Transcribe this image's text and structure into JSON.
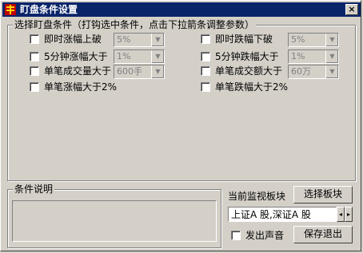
{
  "window": {
    "title": "盯盘条件设置",
    "close_label": "×"
  },
  "conditions_group": {
    "legend": "选择盯盘条件（打钩选中条件，点击下拉箭条调整参数）"
  },
  "left_conditions": [
    {
      "label": "即时涨幅上破",
      "value": "5%",
      "checked": false
    },
    {
      "label": "5分钟涨幅大于",
      "value": "1%",
      "checked": false
    },
    {
      "label": "单笔成交量大于",
      "value": "600手",
      "checked": false
    },
    {
      "label": "单笔涨幅大于2%",
      "checked": false
    }
  ],
  "right_conditions": [
    {
      "label": "即时跌幅下破",
      "value": "5%",
      "checked": false
    },
    {
      "label": "5分钟跌幅大于",
      "value": "1%",
      "checked": false
    },
    {
      "label": "单笔成交额大于",
      "value": "60万",
      "checked": false
    },
    {
      "label": "单笔跌幅大于2%",
      "checked": false
    }
  ],
  "description_group": {
    "legend": "条件说明",
    "text": ""
  },
  "monitor": {
    "label": "当前监视板块",
    "select_button": "选择板块",
    "board_value": "上证A 股,深证A 股",
    "spin_left": "◂",
    "spin_right": "▸"
  },
  "sound": {
    "label": "发出声音",
    "checked": false
  },
  "save_button": "保存退出",
  "icons": {
    "app": "app-icon",
    "dropdown": "chevron-down-icon",
    "close": "close-icon"
  },
  "colors": {
    "titlebar": "#0a246a",
    "face": "#d4d0c8"
  }
}
